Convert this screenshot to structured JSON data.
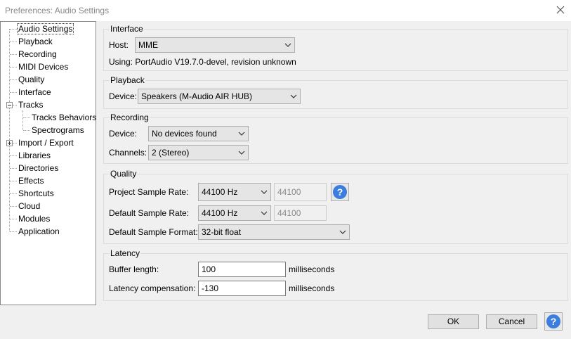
{
  "window": {
    "title": "Preferences: Audio Settings"
  },
  "sidebar": {
    "items": [
      "Audio Settings",
      "Playback",
      "Recording",
      "MIDI Devices",
      "Quality",
      "Interface",
      "Tracks",
      "Tracks Behaviors",
      "Spectrograms",
      "Import / Export",
      "Libraries",
      "Directories",
      "Effects",
      "Shortcuts",
      "Cloud",
      "Modules",
      "Application"
    ],
    "selected": "Audio Settings"
  },
  "interface": {
    "header": "Interface",
    "host_label": "Host:",
    "host_value": "MME",
    "using_text": "Using: PortAudio V19.7.0-devel, revision unknown"
  },
  "playback": {
    "header": "Playback",
    "device_label": "Device:",
    "device_value": "Speakers (M-Audio AIR HUB)"
  },
  "recording": {
    "header": "Recording",
    "device_label": "Device:",
    "device_value": "No devices found",
    "channels_label": "Channels:",
    "channels_value": "2 (Stereo)"
  },
  "quality": {
    "header": "Quality",
    "project_rate_label": "Project Sample Rate:",
    "project_rate_value": "44100 Hz",
    "project_rate_text": "44100",
    "default_rate_label": "Default Sample Rate:",
    "default_rate_value": "44100 Hz",
    "default_rate_text": "44100",
    "default_format_label": "Default Sample Format:",
    "default_format_value": "32-bit float"
  },
  "latency": {
    "header": "Latency",
    "buffer_label": "Buffer length:",
    "buffer_value": "100",
    "buffer_unit": "milliseconds",
    "compensation_label": "Latency compensation:",
    "compensation_value": "-130",
    "compensation_unit": "milliseconds"
  },
  "footer": {
    "ok_label": "OK",
    "cancel_label": "Cancel",
    "help_glyph": "?"
  }
}
